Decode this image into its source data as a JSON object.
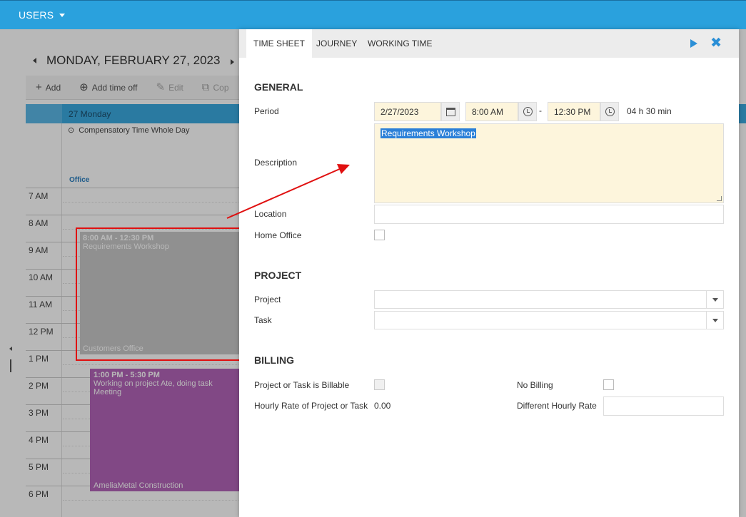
{
  "topbar": {
    "users_label": "USERS"
  },
  "calendar": {
    "date_title": "MONDAY, FEBRUARY 27, 2023",
    "toolbar": {
      "add": "Add",
      "add_time_off": "Add time off",
      "edit": "Edit",
      "copy": "Cop"
    },
    "day_header": "27 Monday",
    "allday_event": "Compensatory Time Whole Day",
    "allday_location": "Office",
    "hours": [
      "7 AM",
      "8 AM",
      "9 AM",
      "10 AM",
      "11 AM",
      "12 PM",
      "1 PM",
      "2 PM",
      "3 PM",
      "4 PM",
      "5 PM",
      "6 PM"
    ],
    "event1": {
      "time": "8:00 AM - 12:30 PM",
      "title": "Requirements Workshop",
      "location": "Customers Office"
    },
    "event2": {
      "time": "1:00 PM - 5:30 PM",
      "title": "Working on project Ate, doing task Meeting",
      "location": "AmeliaMetal Construction"
    }
  },
  "dialog": {
    "tabs": [
      "TIME SHEET",
      "JOURNEY",
      "WORKING TIME"
    ],
    "general": {
      "heading": "GENERAL",
      "period_label": "Period",
      "date": "2/27/2023",
      "start": "8:00 AM",
      "separator": "-",
      "end": "12:30 PM",
      "duration": "04 h 30 min",
      "description_label": "Description",
      "description": "Requirements Workshop",
      "location_label": "Location",
      "home_office_label": "Home Office"
    },
    "project": {
      "heading": "PROJECT",
      "project_label": "Project",
      "task_label": "Task"
    },
    "billing": {
      "heading": "BILLING",
      "billable_label": "Project or Task is Billable",
      "no_billing_label": "No Billing",
      "hourly_rate_label": "Hourly Rate of Project or Task",
      "hourly_rate_value": "0.00",
      "different_rate_label": "Different Hourly Rate"
    }
  },
  "colors": {
    "topbar": "#2aa1dd",
    "accent": "#2b8fd6",
    "annotation": "#e01010",
    "event_purple": "#b364b9",
    "input_yellow": "#fdf5dc"
  }
}
